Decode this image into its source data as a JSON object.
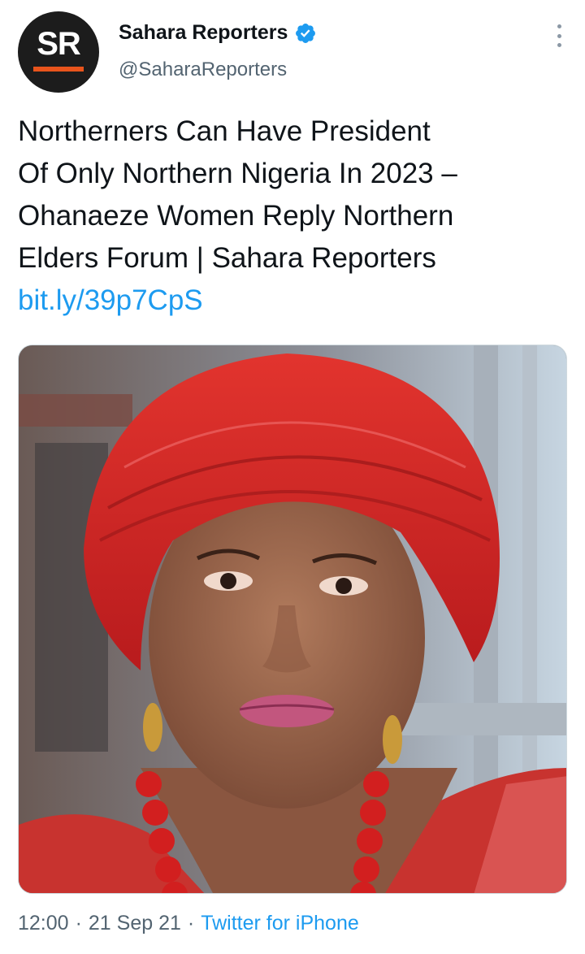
{
  "account": {
    "avatar_text": "SR",
    "display_name": "Sahara Reporters",
    "handle": "@SaharaReporters",
    "verified": true
  },
  "tweet": {
    "text": "Northerners Can Have President\nOf Only Northern Nigeria In 2023 –\nOhanaeze Women Reply Northern\nElders Forum | Sahara Reporters",
    "link": "bit.ly/39p7CpS"
  },
  "media": {
    "subject": "photo of a woman wearing a red head tie and red coral beads"
  },
  "meta": {
    "time": "12:00",
    "separator": "·",
    "date": "21 Sep 21",
    "source": "Twitter for iPhone"
  },
  "colors": {
    "link": "#1d9bf0",
    "secondary_text": "#536471",
    "avatar_bg": "#1c1c1c",
    "avatar_accent": "#e8541c",
    "verified": "#1d9bf0"
  },
  "icons": {
    "verified": "verified-badge-icon",
    "more": "more-options-icon"
  }
}
